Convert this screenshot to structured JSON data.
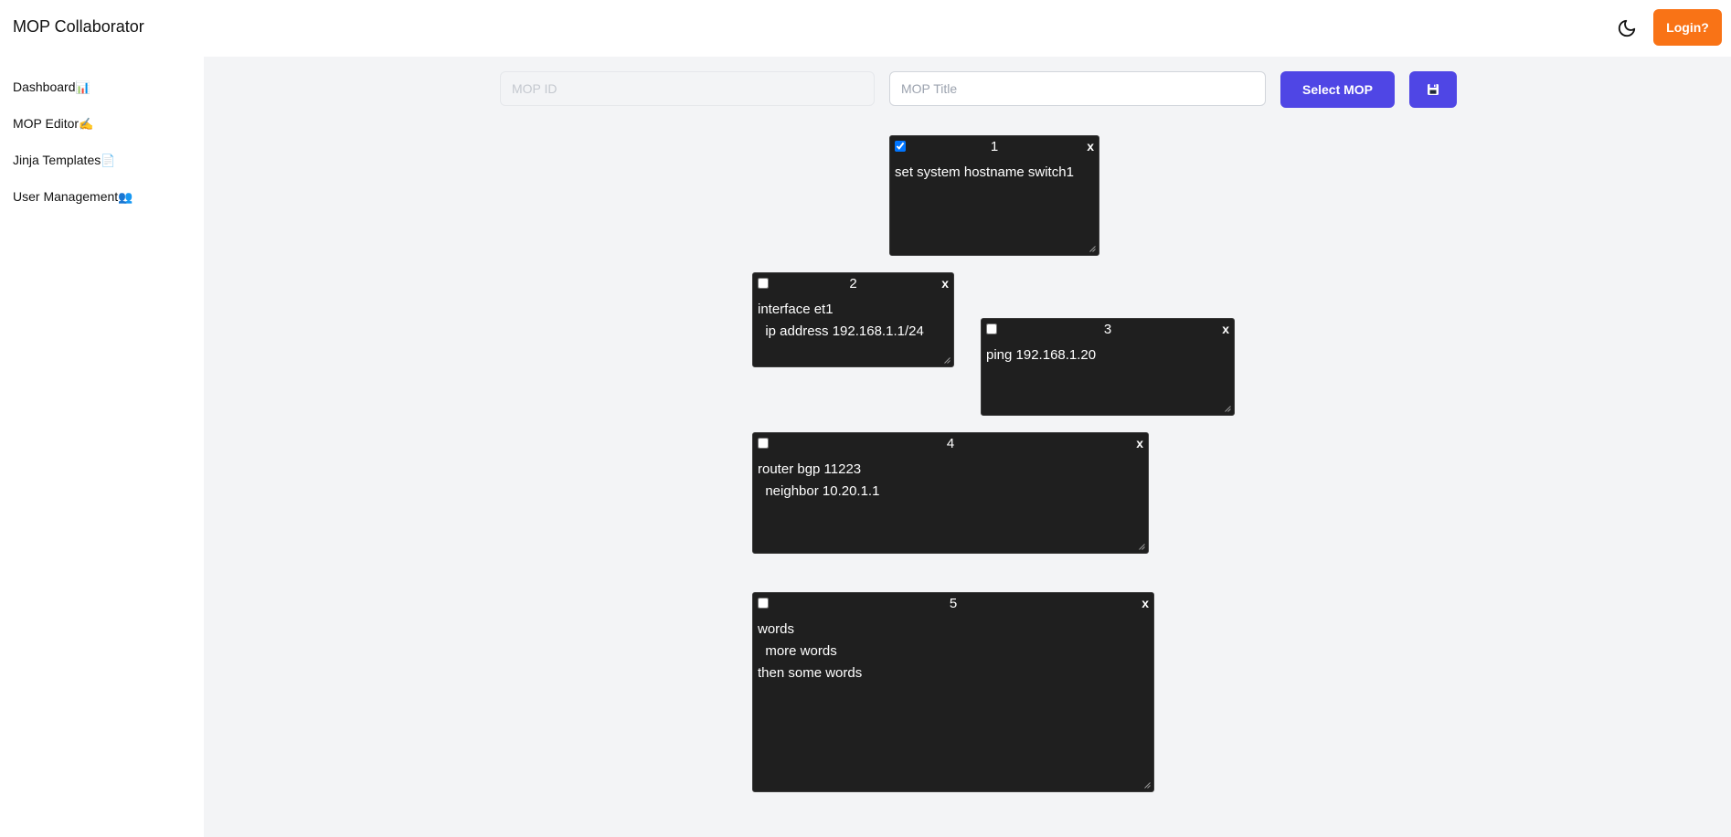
{
  "header": {
    "app_title": "MOP Collaborator",
    "theme_icon": "moon-icon",
    "login_label": "Login?",
    "login_color": "#f97316"
  },
  "sidebar": {
    "items": [
      {
        "label": "Dashboard",
        "emoji": "📊"
      },
      {
        "label": "MOP Editor",
        "emoji": "✍️"
      },
      {
        "label": "Jinja Templates",
        "emoji": "📄"
      },
      {
        "label": "User Management",
        "emoji": "👥"
      }
    ]
  },
  "toolbar": {
    "mop_id_placeholder": "MOP ID",
    "mop_id_value": "",
    "mop_title_placeholder": "MOP Title",
    "mop_title_value": "",
    "select_label": "Select MOP",
    "save_icon": "floppy-disk-icon",
    "accent_color": "#4f46e5"
  },
  "cards": [
    {
      "number": "1",
      "checked": true,
      "close_label": "x",
      "content": "set system hostname switch1"
    },
    {
      "number": "2",
      "checked": false,
      "close_label": "x",
      "content": "interface et1\n  ip address 192.168.1.1/24"
    },
    {
      "number": "3",
      "checked": false,
      "close_label": "x",
      "content": "ping 192.168.1.20"
    },
    {
      "number": "4",
      "checked": false,
      "close_label": "x",
      "content": "router bgp 11223\n  neighbor 10.20.1.1"
    },
    {
      "number": "5",
      "checked": false,
      "close_label": "x",
      "content": "words\n  more words\nthen some words"
    }
  ]
}
